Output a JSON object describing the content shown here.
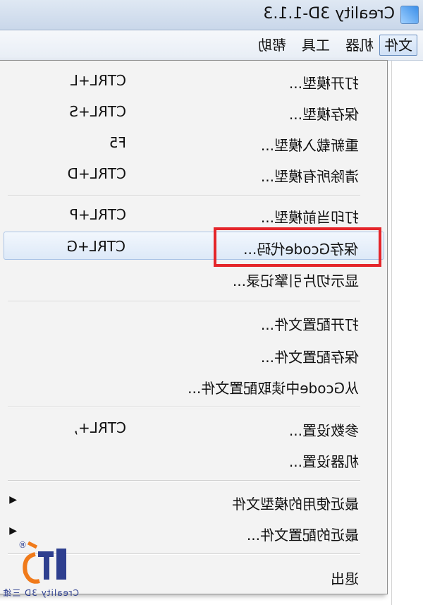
{
  "window": {
    "title": "Creality 3D-1.1.3"
  },
  "menubar": {
    "items": [
      "文件",
      "机器",
      "工具",
      "帮助"
    ]
  },
  "menu": {
    "items": [
      {
        "label": "打开模型...",
        "shortcut": "CTRL+L"
      },
      {
        "label": "保存模型...",
        "shortcut": "CTRL+S"
      },
      {
        "label": "重新载入模型...",
        "shortcut": "F5"
      },
      {
        "label": "清除所有模型...",
        "shortcut": "CTRL+D"
      },
      {
        "label": "打印当前模型...",
        "shortcut": "CTRL+P"
      },
      {
        "label": "保存Gcode代码...",
        "shortcut": "CTRL+G"
      },
      {
        "label": "显示切片引擎记录..."
      },
      {
        "label": "打开配置文件..."
      },
      {
        "label": "保存配置文件..."
      },
      {
        "label": "从Gcode中读取配置文件..."
      },
      {
        "label": "参数设置...",
        "shortcut": "CTRL+,"
      },
      {
        "label": "机器设置..."
      },
      {
        "label": "最近使用的模型文件",
        "arrow": "◀"
      },
      {
        "label": "最近的配置文件...",
        "arrow": "◀"
      },
      {
        "label": "退出"
      }
    ]
  },
  "logo": {
    "text": "Creality 3D",
    "reg": "®",
    "cn": "三维"
  },
  "colors": {
    "highlight": "#e4252a",
    "accent": "#2f7fe0"
  }
}
